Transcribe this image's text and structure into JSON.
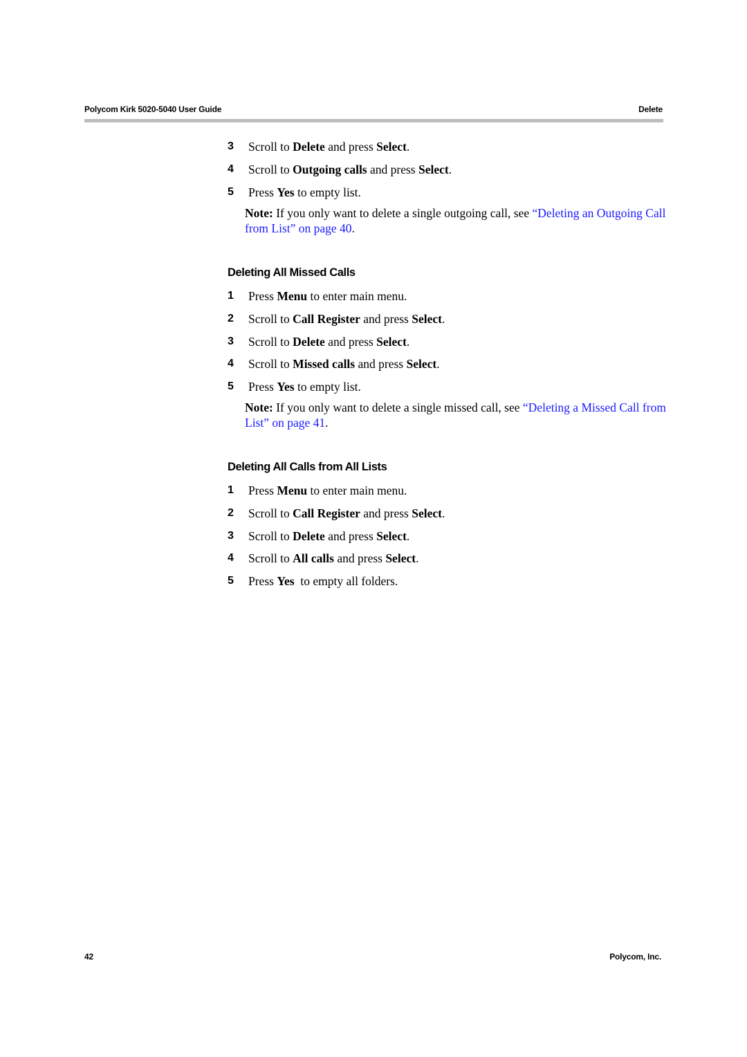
{
  "header": {
    "doc_title": "Polycom Kirk 5020-5040 User Guide",
    "section": "Delete"
  },
  "footer": {
    "page_number": "42",
    "company": "Polycom, Inc."
  },
  "colors": {
    "link": "#1a1aff",
    "rule": "#bdbdbd"
  },
  "outgoing": {
    "steps": [
      {
        "num": "3",
        "pre": "Scroll to ",
        "b1": "Delete",
        "mid": " and press ",
        "b2": "Select",
        "post": "."
      },
      {
        "num": "4",
        "pre": "Scroll to ",
        "b1": "Outgoing calls",
        "mid": " and press ",
        "b2": "Select",
        "post": "."
      },
      {
        "num": "5",
        "pre": "Press ",
        "b1": "Yes",
        "mid": " to empty list.",
        "b2": "",
        "post": ""
      }
    ],
    "note": {
      "label": "Note:",
      "text": " If you only want to delete a single outgoing call, see ",
      "link": "“Deleting an Outgoing Call from List” on page 40",
      "end": "."
    }
  },
  "missed": {
    "title": "Deleting All Missed Calls",
    "steps": [
      {
        "num": "1",
        "pre": "Press ",
        "b1": "Menu",
        "mid": " to enter main menu.",
        "b2": "",
        "post": ""
      },
      {
        "num": "2",
        "pre": "Scroll to ",
        "b1": "Call Register",
        "mid": " and press ",
        "b2": "Select",
        "post": "."
      },
      {
        "num": "3",
        "pre": "Scroll to ",
        "b1": "Delete",
        "mid": " and press ",
        "b2": "Select",
        "post": "."
      },
      {
        "num": "4",
        "pre": "Scroll to ",
        "b1": "Missed calls",
        "mid": " and press ",
        "b2": "Select",
        "post": "."
      },
      {
        "num": "5",
        "pre": "Press ",
        "b1": "Yes",
        "mid": " to empty list.",
        "b2": "",
        "post": ""
      }
    ],
    "note": {
      "label": "Note:",
      "text": " If you only want to delete a single missed call, see ",
      "link": "“Deleting a Missed Call from List” on page 41",
      "end": "."
    }
  },
  "all": {
    "title": "Deleting All Calls from All Lists",
    "steps": [
      {
        "num": "1",
        "pre": "Press ",
        "b1": "Menu",
        "mid": " to enter main menu.",
        "b2": "",
        "post": ""
      },
      {
        "num": "2",
        "pre": "Scroll to ",
        "b1": "Call Register",
        "mid": " and press ",
        "b2": "Select",
        "post": "."
      },
      {
        "num": "3",
        "pre": "Scroll to ",
        "b1": "Delete",
        "mid": " and press ",
        "b2": "Select",
        "post": "."
      },
      {
        "num": "4",
        "pre": "Scroll to ",
        "b1": "All calls",
        "mid": " and press ",
        "b2": "Select",
        "post": "."
      },
      {
        "num": "5",
        "pre": "Press ",
        "b1": "Yes",
        "mid": "  to empty all folders.",
        "b2": "",
        "post": ""
      }
    ]
  }
}
